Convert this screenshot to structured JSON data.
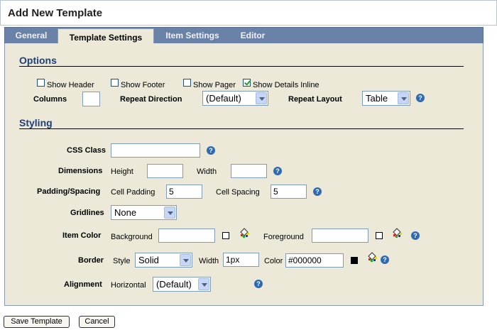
{
  "title": "Add New Template",
  "tabs": [
    {
      "label": "General"
    },
    {
      "label": "Template Settings"
    },
    {
      "label": "Item Settings"
    },
    {
      "label": "Editor"
    }
  ],
  "active_tab": "Template Settings",
  "options": {
    "heading": "Options",
    "show_header": {
      "label": "Show Header",
      "checked": false
    },
    "show_footer": {
      "label": "Show Footer",
      "checked": false
    },
    "show_pager": {
      "label": "Show Pager",
      "checked": false
    },
    "show_details_inline": {
      "label": "Show Details Inline",
      "checked": true
    },
    "columns_label": "Columns",
    "columns_value": "",
    "repeat_direction_label": "Repeat Direction",
    "repeat_direction_value": "(Default)",
    "repeat_layout_label": "Repeat Layout",
    "repeat_layout_value": "Table"
  },
  "styling": {
    "heading": "Styling",
    "css_class_label": "CSS Class",
    "css_class_value": "",
    "dimensions_label": "Dimensions",
    "height_label": "Height",
    "height_value": "",
    "width_label": "Width",
    "width_value": "",
    "padding_spacing_label": "Padding/Spacing",
    "cell_padding_label": "Cell Padding",
    "cell_padding_value": "5",
    "cell_spacing_label": "Cell Spacing",
    "cell_spacing_value": "5",
    "gridlines_label": "Gridlines",
    "gridlines_value": "None",
    "item_color_label": "Item Color",
    "background_label": "Background",
    "background_value": "",
    "background_swatch": "#ffffff",
    "foreground_label": "Foreground",
    "foreground_value": "",
    "foreground_swatch": "#ffffff",
    "border_label": "Border",
    "border_style_label": "Style",
    "border_style_value": "Solid",
    "border_width_label": "Width",
    "border_width_value": "1px",
    "border_color_label": "Color",
    "border_color_value": "#000000",
    "border_swatch": "#000000",
    "alignment_label": "Alignment",
    "horizontal_label": "Horizontal",
    "horizontal_value": "(Default)"
  },
  "buttons": {
    "save": "Save Template",
    "cancel": "Cancel"
  },
  "icons": {
    "help": "help-icon",
    "color_picker": "color-picker-icon"
  },
  "colors": {
    "tab_strip": "#6a82a8",
    "panel": "#ece9d8",
    "section_heading": "#1f3f7a",
    "help_icon": "#2f6bb3"
  }
}
